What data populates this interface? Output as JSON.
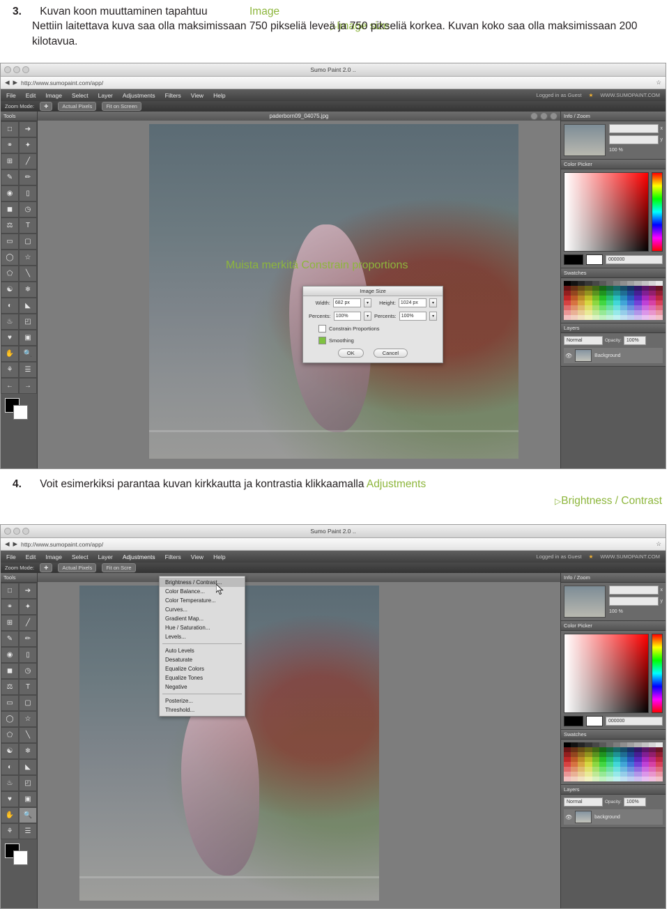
{
  "steps": [
    {
      "number": "3.",
      "title": "Kuvan koon muuttaminen tapahtuu",
      "menu_path_1": "Image",
      "menu_path_2": "Image size",
      "body": "Nettiin laitettava kuva saa olla maksimissaan 750 pikseliä leveä ja 750 pikseliä korkea. Kuvan koko saa olla maksimissaan 200 kilotavua."
    },
    {
      "number": "4.",
      "title": "Voit esimerkiksi parantaa kuvan kirkkautta ja kontrastia klikkaamalla",
      "menu_path_1": "Adjustments",
      "menu_path_2": "Brightness / Contrast"
    }
  ],
  "accent_color": "#8db63c",
  "screenshot1": {
    "window_title": "Sumo Paint 2.0 ..",
    "url": "http://www.sumopaint.com/app/",
    "menu": [
      "File",
      "Edit",
      "Image",
      "Select",
      "Layer",
      "Adjustments",
      "Filters",
      "View",
      "Help"
    ],
    "login_status": "Logged in as Guest",
    "brand": "WWW.SUMOPAINT.COM",
    "toolbar": {
      "zoom_mode_label": "Zoom Mode:",
      "actual_pixels": "Actual Pixels",
      "fit_on_screen": "Fit on Screen"
    },
    "tools_panel_title": "Tools",
    "canvas_title": "paderborn09_04075.jpg",
    "overlay_note": "Muista merkitä Constrain proportions",
    "right_panels": {
      "info_zoom": "Info / Zoom",
      "zoom_value": "100 %",
      "axis_x": "x",
      "axis_y": "y",
      "color_picker": "Color Picker",
      "color_hex": "000000",
      "swatches": "Swatches",
      "layers": "Layers",
      "blend_mode": "Normal",
      "opacity_label": "Opacity:",
      "opacity_value": "100%",
      "layer_name": "Background"
    },
    "dialog": {
      "title": "Image Size",
      "width_label": "Width:",
      "width_value": "682 px",
      "height_label": "Height:",
      "height_value": "1024 px",
      "percents_label_1": "Percents:",
      "percents_value_1": "100%",
      "percents_label_2": "Percents:",
      "percents_value_2": "100%",
      "constrain_label": "Constrain Proportions",
      "constrain_checked": false,
      "smoothing_label": "Smoothing",
      "smoothing_checked": true,
      "ok_label": "OK",
      "cancel_label": "Cancel"
    }
  },
  "screenshot2": {
    "window_title": "Sumo Paint 2.0 ..",
    "url": "http://www.sumopaint.com/app/",
    "menu": [
      "File",
      "Edit",
      "Image",
      "Select",
      "Layer",
      "Adjustments",
      "Filters",
      "View",
      "Help"
    ],
    "login_status": "Logged in as Guest",
    "brand": "WWW.SUMOPAINT.COM",
    "toolbar": {
      "zoom_mode_label": "Zoom Mode:",
      "actual_pixels": "Actual Pixels",
      "fit_on_screen": "Fit on Scre"
    },
    "tools_panel_title": "Tools",
    "adjustments_menu": [
      "Brightness / Contrast...",
      "Color Balance...",
      "Color Temperature...",
      "Curves...",
      "Gradient Map...",
      "Hue / Saturation...",
      "Levels...",
      "Auto Levels",
      "Desaturate",
      "Equalize Colors",
      "Equalize Tones",
      "Negative",
      "Posterize...",
      "Threshold..."
    ],
    "adjustments_menu_highlight": "Brightness / Contrast...",
    "right_panels": {
      "info_zoom": "Info / Zoom",
      "zoom_value": "100 %",
      "axis_x": "x",
      "axis_y": "y",
      "color_picker": "Color Picker",
      "color_hex": "000000",
      "swatches": "Swatches",
      "layers": "Layers",
      "blend_mode": "Normal",
      "opacity_label": "Opacity:",
      "opacity_value": "100%",
      "layer_name": "background"
    }
  }
}
